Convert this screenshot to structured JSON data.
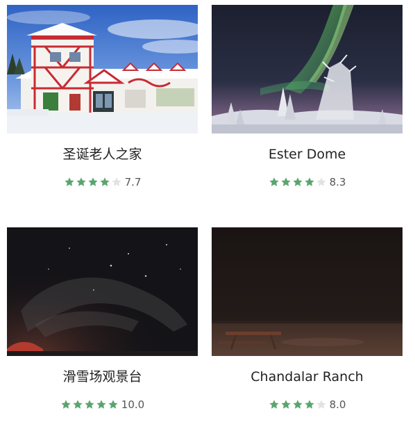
{
  "colors": {
    "star_on": "#5aa56e",
    "star_off": "#e2e2e2"
  },
  "cards": [
    {
      "image": "santa-claus-house-photo",
      "title": "圣诞老人之家",
      "stars": 4,
      "score": "7.7"
    },
    {
      "image": "aurora-over-snowy-trees-photo",
      "title": "Ester Dome",
      "stars": 4,
      "score": "8.3"
    },
    {
      "image": "night-sky-with-stars-photo",
      "title": "滑雪场观景台",
      "stars": 5,
      "score": "10.0"
    },
    {
      "image": "dark-snowy-field-with-bench-photo",
      "title": "Chandalar Ranch",
      "stars": 4,
      "score": "8.0"
    }
  ]
}
